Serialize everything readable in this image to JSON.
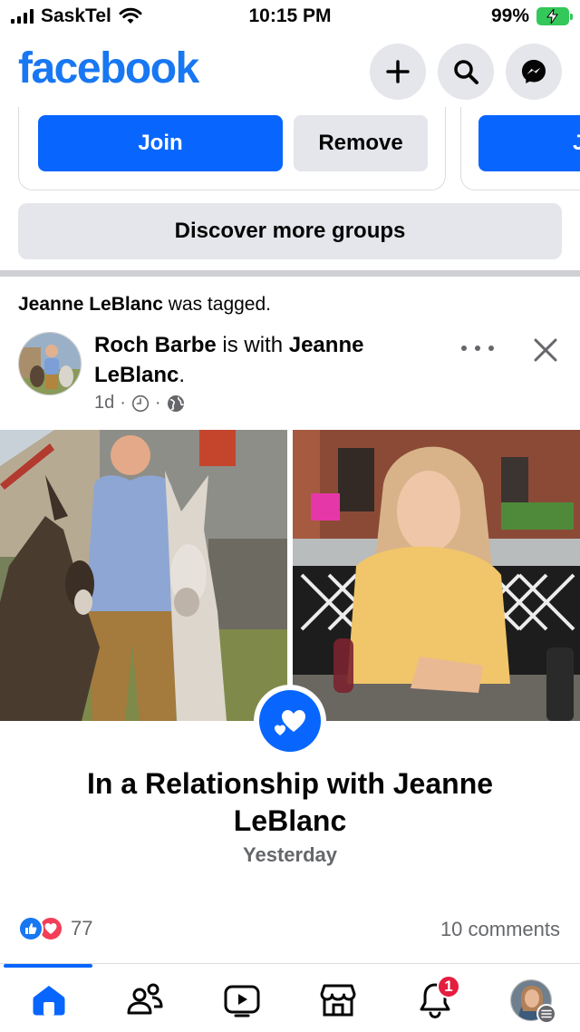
{
  "status_bar": {
    "carrier": "SaskTel",
    "time": "10:15 PM",
    "battery": "99%"
  },
  "header": {
    "logo": "facebook",
    "icons": [
      "plus-icon",
      "search-icon",
      "messenger-icon"
    ]
  },
  "group_suggestions": {
    "join_label": "Join",
    "remove_label": "Remove",
    "join_next_label": "J",
    "discover_label": "Discover more groups"
  },
  "post": {
    "tag_notice": {
      "name": "Jeanne LeBlanc",
      "text": "was tagged."
    },
    "author": {
      "name": "Roch Barbe",
      "connector": "is with",
      "with_name": "Jeanne LeBlanc",
      "suffix": "."
    },
    "time": "1d",
    "separator": "·",
    "life_event": {
      "title": "In a Relationship with Jeanne LeBlanc",
      "date": "Yesterday"
    },
    "reactions": {
      "count": "77",
      "types": [
        "like",
        "love"
      ]
    },
    "comments": "10 comments"
  },
  "tab_bar": {
    "tabs": [
      "home",
      "friends",
      "video",
      "marketplace",
      "notifications",
      "menu"
    ],
    "active": "home",
    "notification_badge": "1"
  },
  "colors": {
    "brand": "#1877f2",
    "button_blue": "#0866ff",
    "secondary_bg": "#e4e6eb",
    "secondary_text": "#65676b",
    "love": "#f33e58",
    "badge": "#e41e3f"
  }
}
